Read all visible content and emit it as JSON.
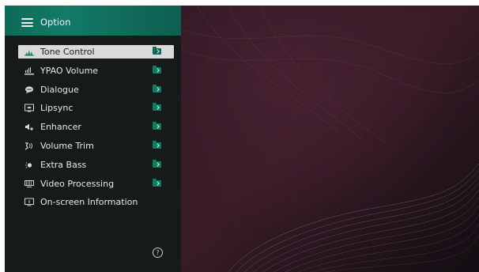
{
  "header": {
    "title": "Option",
    "menu_icon": "hamburger-menu-icon"
  },
  "menu": {
    "items": [
      {
        "label": "Tone Control",
        "icon": "tone-control-icon",
        "has_folder": true,
        "selected": true
      },
      {
        "label": "YPAO Volume",
        "icon": "ypao-volume-icon",
        "has_folder": true,
        "selected": false
      },
      {
        "label": "Dialogue",
        "icon": "dialogue-icon",
        "has_folder": true,
        "selected": false
      },
      {
        "label": "Lipsync",
        "icon": "lipsync-icon",
        "has_folder": true,
        "selected": false
      },
      {
        "label": "Enhancer",
        "icon": "enhancer-icon",
        "has_folder": true,
        "selected": false
      },
      {
        "label": "Volume Trim",
        "icon": "volume-trim-icon",
        "has_folder": true,
        "selected": false
      },
      {
        "label": "Extra Bass",
        "icon": "extra-bass-icon",
        "has_folder": true,
        "selected": false
      },
      {
        "label": "Video Processing",
        "icon": "video-processing-icon",
        "has_folder": true,
        "selected": false
      },
      {
        "label": "On-screen Information",
        "icon": "onscreen-info-icon",
        "has_folder": false,
        "selected": false
      }
    ]
  },
  "help": {
    "glyph": "?",
    "icon": "help-icon"
  },
  "colors": {
    "header_accent": "#127a66",
    "panel_background": "#161b1a",
    "selected_background": "#d9d9d9",
    "folder_icon": "#0f7b63",
    "wallpaper_base": "#1c1218"
  }
}
